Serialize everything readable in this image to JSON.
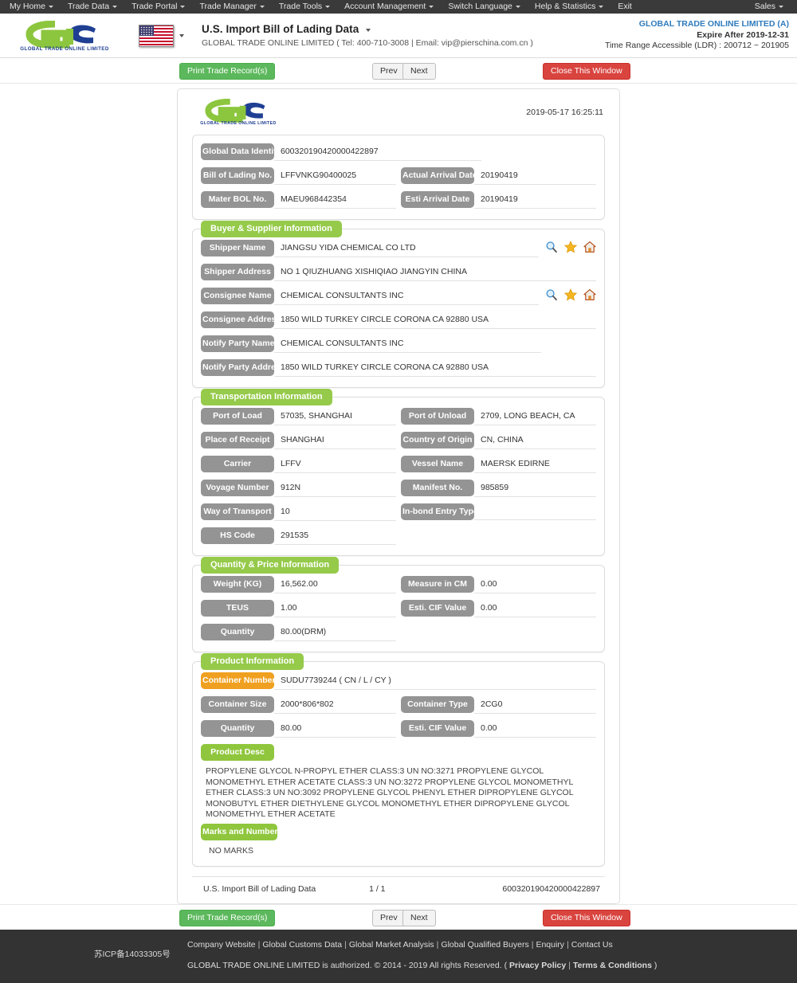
{
  "topnav": {
    "items": [
      {
        "label": "My Home",
        "caret": true
      },
      {
        "label": "Trade Data",
        "caret": true
      },
      {
        "label": "Trade Portal",
        "caret": true
      },
      {
        "label": "Trade Manager",
        "caret": true
      },
      {
        "label": "Trade Tools",
        "caret": true
      },
      {
        "label": "Account Management",
        "caret": true
      },
      {
        "label": "Switch Language",
        "caret": true
      },
      {
        "label": "Help & Statistics",
        "caret": true
      },
      {
        "label": "Exit",
        "caret": false
      }
    ],
    "right": {
      "label": "Sales",
      "caret": true
    }
  },
  "header": {
    "logo_text": "GLOBAL TRADE ONLINE LIMITED",
    "flag": "us-flag-icon",
    "page_title": "U.S. Import Bill of Lading Data",
    "sub_title": "GLOBAL TRADE ONLINE LIMITED ( Tel: 400-710-3008 | Email: vip@pierschina.com.cn )",
    "account_name": "GLOBAL TRADE ONLINE LIMITED (A)",
    "expire": "Expire After 2019-12-31",
    "time_range": "Time Range Accessible (LDR) : 200712 ~ 201905",
    "accent_blue": "#2f7bbd"
  },
  "toolbar": {
    "print_label": "Print Trade Record(s)",
    "prev_label": "Prev",
    "next_label": "Next",
    "close_label": "Close This Window",
    "print_color": "#5cb85c",
    "close_color": "#d9443f"
  },
  "document": {
    "timestamp": "2019-05-17 16:25:11",
    "identity": {
      "rows": [
        {
          "label": "Global Data Identity",
          "value": "600320190420000422897",
          "wide": true
        },
        {
          "label": "Bill of Lading No.",
          "value": "LFFVNKG90400025",
          "label2": "Actual Arrival Date",
          "value2": "20190419"
        },
        {
          "label": "Mater BOL No.",
          "value": "MAEU968442354",
          "label2": "Esti Arrival Date",
          "value2": "20190419"
        }
      ]
    },
    "buyer_supplier": {
      "title": "Buyer & Supplier Information",
      "rows": [
        {
          "label": "Shipper Name",
          "value": "JIANGSU YIDA CHEMICAL CO LTD",
          "icons": true
        },
        {
          "label": "Shipper Address",
          "value": "NO 1 QIUZHUANG XISHIQIAO JIANGYIN CHINA",
          "icons": false
        },
        {
          "label": "Consignee Name",
          "value": "CHEMICAL CONSULTANTS INC",
          "icons": true
        },
        {
          "label": "Consignee Address",
          "value": "1850 WILD TURKEY CIRCLE CORONA CA 92880 USA",
          "icons": false
        },
        {
          "label": "Notify Party Name",
          "value": "CHEMICAL CONSULTANTS INC",
          "icons": false
        },
        {
          "label": "Notify Party Address",
          "value": "1850 WILD TURKEY CIRCLE CORONA CA 92880 USA",
          "icons": false
        }
      ],
      "icon_names": [
        "search-icon",
        "star-icon",
        "home-icon"
      ]
    },
    "transportation": {
      "title": "Transportation Information",
      "rows": [
        {
          "label": "Port of Load",
          "value": "57035, SHANGHAI",
          "label2": "Port of Unload",
          "value2": "2709, LONG BEACH, CA"
        },
        {
          "label": "Place of Receipt",
          "value": "SHANGHAI",
          "label2": "Country of Origin",
          "value2": "CN, CHINA"
        },
        {
          "label": "Carrier",
          "value": "LFFV",
          "label2": "Vessel Name",
          "value2": "MAERSK EDIRNE"
        },
        {
          "label": "Voyage Number",
          "value": "912N",
          "label2": "Manifest No.",
          "value2": "985859"
        },
        {
          "label": "Way of Transport",
          "value": "10",
          "label2": "In-bond Entry Type",
          "value2": ""
        },
        {
          "label": "HS Code",
          "value": "291535",
          "label2": "",
          "value2": ""
        }
      ]
    },
    "quantity_price": {
      "title": "Quantity & Price Information",
      "rows": [
        {
          "label": "Weight (KG)",
          "value": "16,562.00",
          "label2": "Measure in CM",
          "value2": "0.00"
        },
        {
          "label": "TEUS",
          "value": "1.00",
          "label2": "Esti. CIF Value",
          "value2": "0.00"
        },
        {
          "label": "Quantity",
          "value": "80.00(DRM)",
          "label2": "",
          "value2": ""
        }
      ]
    },
    "product": {
      "title": "Product Information",
      "container_number_label": "Container Number",
      "container_number_value": "SUDU7739244 ( CN / L / CY )",
      "rows": [
        {
          "label": "Container Size",
          "value": "2000*806*802",
          "label2": "Container Type",
          "value2": "2CG0"
        },
        {
          "label": "Quantity",
          "value": "80.00",
          "label2": "Esti. CIF Value",
          "value2": "0.00"
        }
      ],
      "product_desc_label": "Product Desc",
      "product_desc_value": "PROPYLENE GLYCOL N-PROPYL ETHER CLASS:3 UN NO:3271 PROPYLENE GLYCOL MONOMETHYL ETHER ACETATE CLASS:3 UN NO:3272 PROPYLENE GLYCOL MONOMETHYL ETHER CLASS:3 UN NO:3092 PROPYLENE GLYCOL PHENYL ETHER DIPROPYLENE GLYCOL MONOBUTYL ETHER DIETHYLENE GLYCOL MONOMETHYL ETHER DIPROPYLENE GLYCOL MONOMETHYL ETHER ACETATE",
      "marks_label": "Marks and Numbers",
      "marks_value": "NO MARKS"
    },
    "footer": {
      "left": "U.S. Import Bill of Lading Data",
      "page": "1 / 1",
      "right": "600320190420000422897"
    }
  },
  "sitefooter": {
    "icp": "苏ICP备14033305号",
    "links": [
      "Company Website",
      "Global Customs Data",
      "Global Market Analysis",
      "Global Qualified Buyers",
      "Enquiry",
      "Contact Us"
    ],
    "copyright_prefix": "GLOBAL TRADE ONLINE LIMITED is authorized. © 2014 - 2019 All rights Reserved.  (",
    "privacy": "Privacy Policy",
    "terms": "Terms & Conditions",
    "copyright_suffix": ")"
  }
}
